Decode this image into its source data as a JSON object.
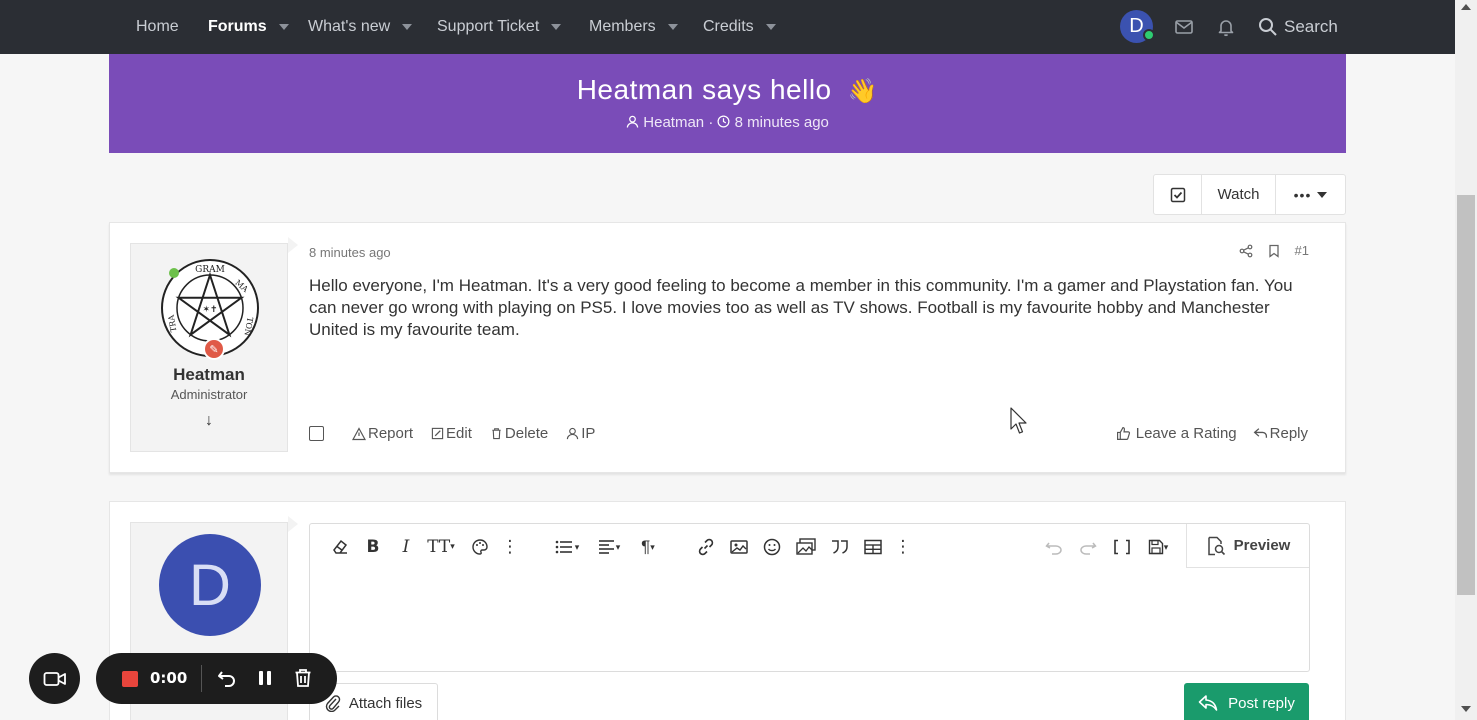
{
  "nav": {
    "items": [
      {
        "label": "Home",
        "caret": false,
        "active": false
      },
      {
        "label": "Forums",
        "caret": true,
        "active": true
      },
      {
        "label": "What's new",
        "caret": true,
        "active": false
      },
      {
        "label": "Support Ticket",
        "caret": true,
        "active": false
      },
      {
        "label": "Members",
        "caret": true,
        "active": false
      },
      {
        "label": "Credits",
        "caret": true,
        "active": false
      }
    ],
    "avatar_letter": "D",
    "search_label": "Search"
  },
  "thread": {
    "title": "Heatman says hello",
    "emoji": "👋",
    "author": "Heatman",
    "separator": "·",
    "time": "8 minutes ago"
  },
  "thread_tools": {
    "watch_label": "Watch",
    "more_label": "•••"
  },
  "post": {
    "time": "8 minutes ago",
    "number": "#1",
    "author": {
      "name": "Heatman",
      "title": "Administrator",
      "expand_glyph": "↓"
    },
    "body": "Hello everyone, I'm Heatman. It's a very good feeling to become a member in this community. I'm a gamer and Playstation fan. You can never go wrong with playing on PS5. I love movies too as well as TV shows. Football is my favourite hobby and Manchester United is my favourite team.",
    "actions": {
      "report": "Report",
      "edit": "Edit",
      "delete": "Delete",
      "ip": "IP",
      "rate": "Leave a Rating",
      "reply": "Reply"
    }
  },
  "reply": {
    "avatar_letter": "D",
    "preview_label": "Preview",
    "attach_label": "Attach files",
    "post_reply_label": "Post reply"
  },
  "recorder": {
    "time": "0:00"
  },
  "colors": {
    "nav_bg": "#2b2e34",
    "banner_bg": "#7a4cb8",
    "post_reply_bg": "#1a9b6c",
    "avatar_bg": "#3b4fb0",
    "online": "#2ecc71"
  }
}
